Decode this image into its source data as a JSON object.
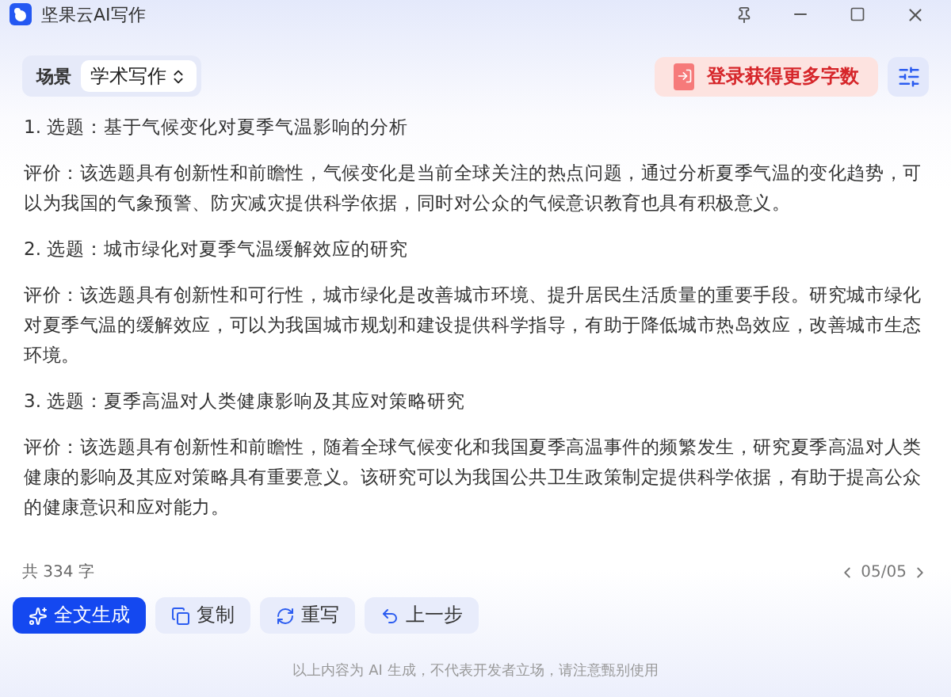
{
  "window": {
    "title": "坚果云AI写作"
  },
  "toolbar": {
    "scene_label": "场景",
    "scene_value": "学术写作",
    "login_button": "登录获得更多字数"
  },
  "items": [
    {
      "title": "1. 选题：基于气候变化对夏季气温影响的分析",
      "review": "评价：该选题具有创新性和前瞻性，气候变化是当前全球关注的热点问题，通过分析夏季气温的变化趋势，可以为我国的气象预警、防灾减灾提供科学依据，同时对公众的气候意识教育也具有积极意义。"
    },
    {
      "title": "2. 选题：城市绿化对夏季气温缓解效应的研究",
      "review": "评价：该选题具有创新性和可行性，城市绿化是改善城市环境、提升居民生活质量的重要手段。研究城市绿化对夏季气温的缓解效应，可以为我国城市规划和建设提供科学指导，有助于降低城市热岛效应，改善城市生态环境。"
    },
    {
      "title": "3. 选题：夏季高温对人类健康影响及其应对策略研究",
      "review": "评价：该选题具有创新性和前瞻性，随着全球气候变化和我国夏季高温事件的频繁发生，研究夏季高温对人类健康的影响及其应对策略具有重要意义。该研究可以为我国公共卫生政策制定提供科学依据，有助于提高公众的健康意识和应对能力。"
    }
  ],
  "word_count": "共 334 字",
  "pager": "05/05",
  "actions": [
    {
      "kind": "primary",
      "label": "全文生成"
    },
    {
      "kind": "secondary",
      "label": "复制"
    },
    {
      "kind": "secondary",
      "label": "重写"
    },
    {
      "kind": "secondary",
      "label": "上一步"
    }
  ],
  "disclaimer": "以上内容为 AI 生成，不代表开发者立场，请注意甄别使用"
}
